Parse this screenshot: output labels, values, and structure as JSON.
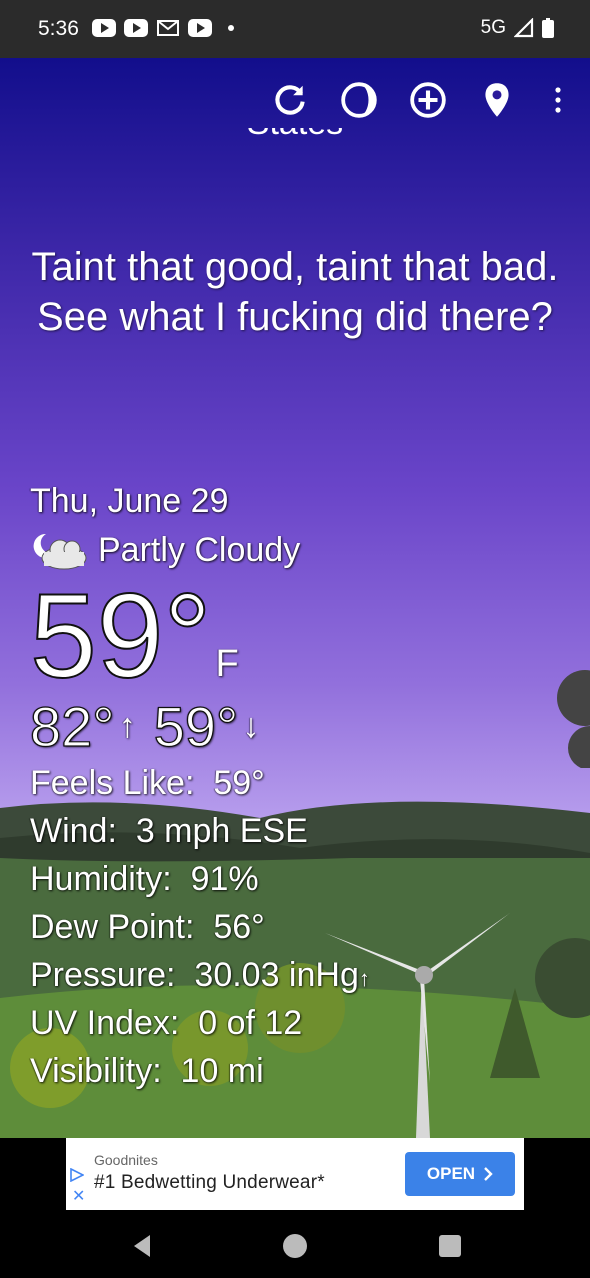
{
  "status_bar": {
    "time": "5:36",
    "network": "5G"
  },
  "toolbar": {
    "icons": [
      "refresh-icon",
      "moon-phase-icon",
      "add-location-icon",
      "location-pin-icon",
      "more-vert-icon"
    ]
  },
  "header": {
    "cut_text": "States"
  },
  "quote": "Taint that good, taint that bad. See what I fucking did there?",
  "weather": {
    "date": "Thu, June 29",
    "condition": "Partly Cloudy",
    "temperature": "59°",
    "unit": "F",
    "high": "82°",
    "low": "59°",
    "details": [
      {
        "label": "Feels Like:",
        "value": "59°"
      },
      {
        "label": "Wind:",
        "value": "3 mph ESE"
      },
      {
        "label": "Humidity:",
        "value": "91%"
      },
      {
        "label": "Dew Point:",
        "value": "56°"
      },
      {
        "label": "Pressure:",
        "value": "30.03 inHg"
      },
      {
        "label": "UV Index:",
        "value": "0 of 12"
      },
      {
        "label": "Visibility:",
        "value": "10 mi"
      }
    ]
  },
  "ad": {
    "brand": "Goodnites",
    "title": "#1 Bedwetting Underwear*",
    "button": "OPEN"
  },
  "colors": {
    "ad_button": "#3b82e8",
    "status_bar": "#2b2b2b"
  }
}
